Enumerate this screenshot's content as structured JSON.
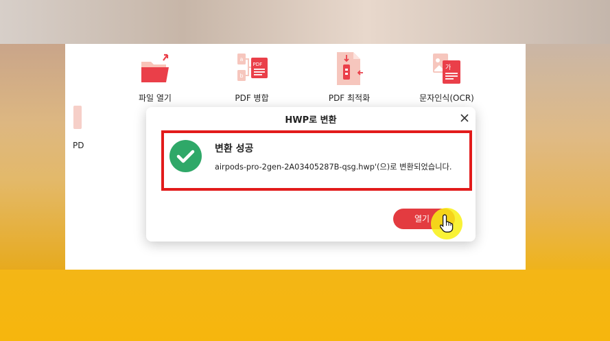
{
  "toolbar": {
    "items": [
      {
        "label": "파일 열기",
        "icon": "folder-open-icon"
      },
      {
        "label": "PDF 병합",
        "icon": "pdf-merge-icon"
      },
      {
        "label": "PDF 최적화",
        "icon": "pdf-compress-icon"
      },
      {
        "label": "문자인식(OCR)",
        "icon": "ocr-icon"
      }
    ],
    "partial_label": "PD"
  },
  "dialog": {
    "title": "HWP로 변환",
    "success_title": "변환 성공",
    "success_message": "airpods-pro-2gen-2A03405287B-qsg.hwp'(으)로 변환되었습니다.",
    "open_button": "열기",
    "close_icon": "close-icon",
    "status_icon": "check-circle-icon"
  },
  "colors": {
    "accent": "#e33b40",
    "success": "#2fa868",
    "highlight": "#e21b1b",
    "icon_light": "#f6c6bd"
  }
}
